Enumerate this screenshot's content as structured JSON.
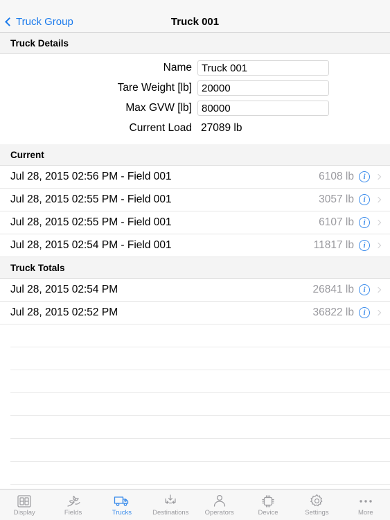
{
  "navbar": {
    "back_label": "Truck Group",
    "title": "Truck 001",
    "back_icon": "chevron-left-icon"
  },
  "sections": {
    "details_header": "Truck Details",
    "current_header": "Current",
    "totals_header": "Truck Totals"
  },
  "details": {
    "fields": [
      {
        "label": "Name",
        "value": "Truck 001",
        "type": "input"
      },
      {
        "label": "Tare Weight [lb]",
        "value": "20000",
        "type": "input"
      },
      {
        "label": "Max GVW [lb]",
        "value": "80000",
        "type": "input"
      },
      {
        "label": "Current Load",
        "value": "27089 lb",
        "type": "static"
      }
    ]
  },
  "current_rows": [
    {
      "title": "Jul 28, 2015 02:56 PM - Field 001",
      "value": "6108 lb"
    },
    {
      "title": "Jul 28, 2015 02:55 PM - Field 001",
      "value": "3057 lb"
    },
    {
      "title": "Jul 28, 2015 02:55 PM - Field 001",
      "value": "6107 lb"
    },
    {
      "title": "Jul 28, 2015 02:54 PM - Field 001",
      "value": "11817 lb"
    }
  ],
  "totals_rows": [
    {
      "title": "Jul 28, 2015 02:54 PM",
      "value": "26841 lb"
    },
    {
      "title": "Jul 28, 2015 02:52 PM",
      "value": "36822 lb"
    }
  ],
  "empty_row_count": 8,
  "row_icons": {
    "info": "info-circle-icon",
    "disclosure": "chevron-right-icon"
  },
  "tabbar": {
    "items": [
      {
        "label": "Display",
        "icon": "seven-segment-display-icon",
        "active": false
      },
      {
        "label": "Fields",
        "icon": "plant-sprout-icon",
        "active": false
      },
      {
        "label": "Trucks",
        "icon": "truck-icon",
        "active": true
      },
      {
        "label": "Destinations",
        "icon": "arrows-into-box-icon",
        "active": false
      },
      {
        "label": "Operators",
        "icon": "person-icon",
        "active": false
      },
      {
        "label": "Device",
        "icon": "chip-icon",
        "active": false
      },
      {
        "label": "Settings",
        "icon": "gear-icon",
        "active": false
      },
      {
        "label": "More",
        "icon": "ellipsis-icon",
        "active": false
      }
    ]
  },
  "colors": {
    "accent": "#3b8ceb",
    "link": "#1a7aec",
    "value_gray": "#9a9a9f",
    "section_bg": "#f4f4f4",
    "chrome_bg": "#f7f7f7"
  }
}
